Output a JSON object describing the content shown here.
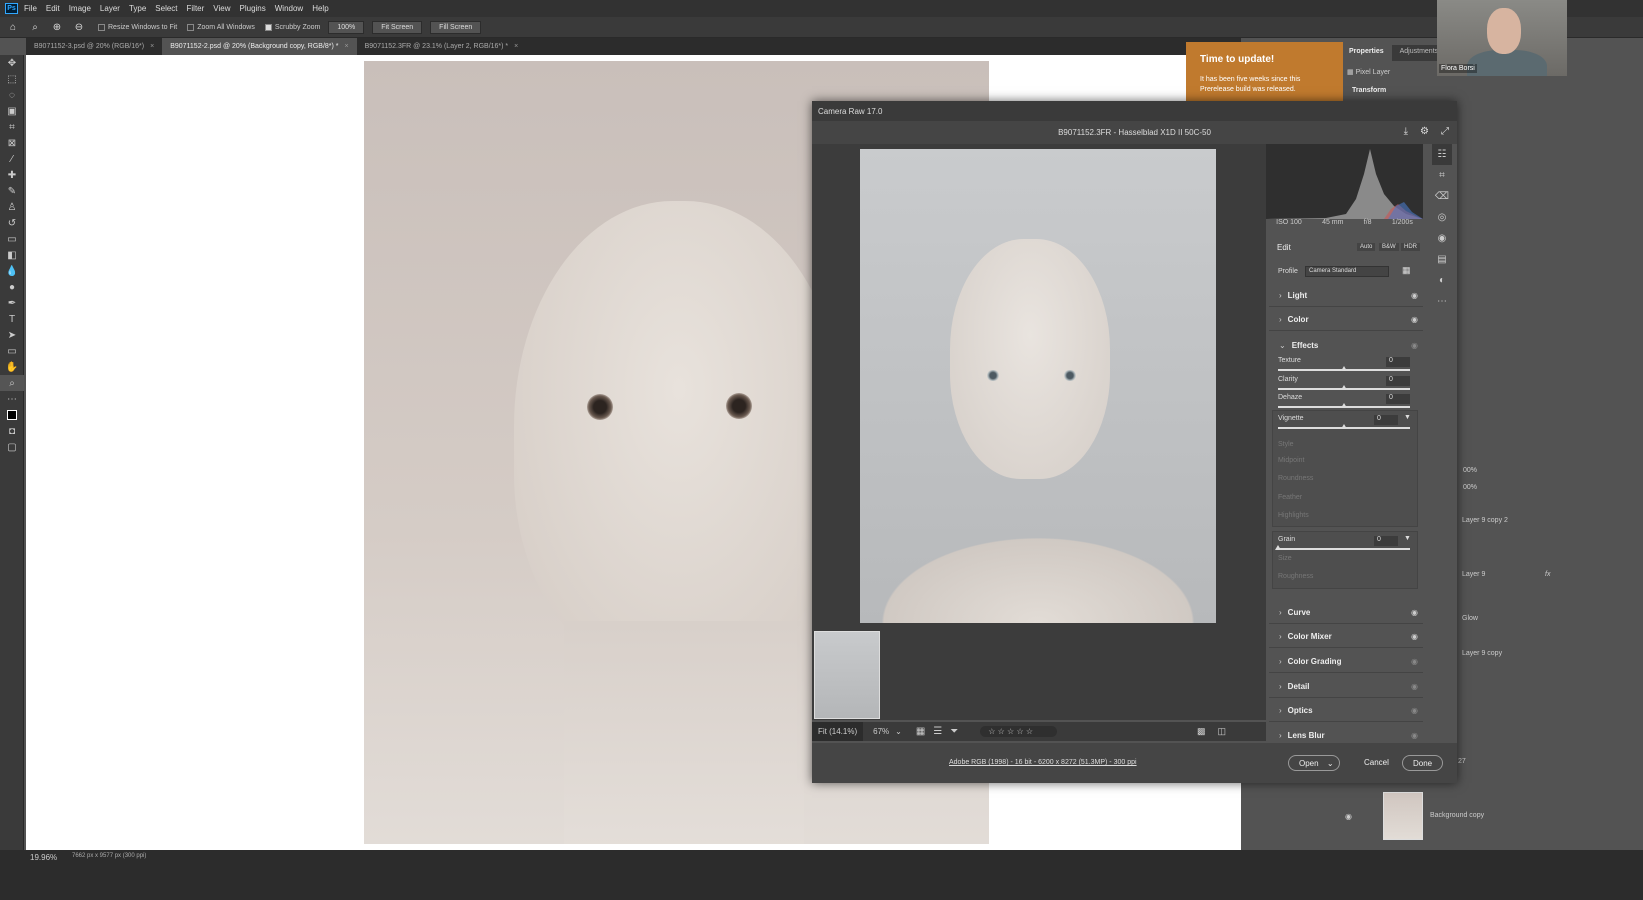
{
  "menu": {
    "items": [
      "File",
      "Edit",
      "Image",
      "Layer",
      "Type",
      "Select",
      "Filter",
      "View",
      "Plugins",
      "Window",
      "Help"
    ]
  },
  "options": {
    "resize": "Resize Windows to Fit",
    "zoom_all": "Zoom All Windows",
    "scrubby": "Scrubby Zoom",
    "zoom_value": "100%",
    "fit_screen": "Fit Screen",
    "fill_screen": "Fill Screen"
  },
  "tabs": [
    {
      "label": "B9071152-3.psd @ 20% (RGB/16*)",
      "close": "×"
    },
    {
      "label": "B9071152-2.psd @ 20% (Background copy, RGB/8*) *",
      "close": "×"
    },
    {
      "label": "B9071152.3FR @ 23.1% (Layer 2, RGB/16*) *",
      "close": "×"
    }
  ],
  "status": {
    "zoom": "19.96%",
    "dimensions": "7662 px x 9577 px (300 ppi)"
  },
  "update_notice": {
    "title": "Time to update!",
    "message": "It has been five weeks since this Prerelease build was released."
  },
  "properties": {
    "tabs": [
      "Properties",
      "Adjustments",
      "Li"
    ],
    "pixel_layer": "Pixel Layer",
    "transform": "Transform"
  },
  "webcam": {
    "name": "Flora Borsi"
  },
  "layers": {
    "items": [
      "Layer 9 copy 2",
      "Layer 9",
      "Glow",
      "Layer 9 copy",
      "Background copy"
    ],
    "pct1": "00%",
    "pct2": "00%",
    "num": "27",
    "fx": "fx"
  },
  "camera_raw": {
    "title": "Camera Raw 17.0",
    "file": "B9071152.3FR  -  Hasselblad X1D II 50C-50",
    "exif": {
      "iso": "ISO 100",
      "focal": "45 mm",
      "aperture": "f/8",
      "shutter": "1/200s"
    },
    "edit": {
      "label": "Edit",
      "auto": "Auto",
      "bw": "B&W",
      "hdr": "HDR"
    },
    "profile": {
      "label": "Profile",
      "value": "Camera Standard"
    },
    "sections": {
      "light": "Light",
      "color": "Color",
      "effects": "Effects",
      "curve": "Curve",
      "color_mixer": "Color Mixer",
      "color_grading": "Color Grading",
      "detail": "Detail",
      "optics": "Optics",
      "lens_blur": "Lens Blur"
    },
    "effects": {
      "texture": {
        "label": "Texture",
        "value": "0"
      },
      "clarity": {
        "label": "Clarity",
        "value": "0"
      },
      "dehaze": {
        "label": "Dehaze",
        "value": "0"
      },
      "vignette": {
        "label": "Vignette",
        "value": "0"
      },
      "style": "Style",
      "midpoint": "Midpoint",
      "roundness": "Roundness",
      "feather": "Feather",
      "highlights": "Highlights",
      "grain": {
        "label": "Grain",
        "value": "0"
      },
      "grain_size": "Size",
      "grain_roughness": "Roughness"
    },
    "preview": {
      "fit": "Fit (14.1%)",
      "zoom": "67%",
      "stars": "☆ ☆ ☆ ☆ ☆"
    },
    "footer": {
      "workflow": "Adobe RGB (1998) - 16 bit - 6200 x 8272 (51.3MP) - 300 ppi",
      "open": "Open",
      "cancel": "Cancel",
      "done": "Done"
    }
  },
  "colors": {
    "accent_update": "#c07a2e",
    "panel": "#535353",
    "dark": "#323232"
  }
}
